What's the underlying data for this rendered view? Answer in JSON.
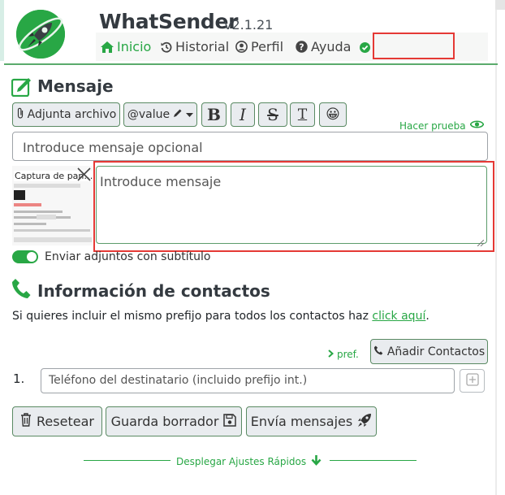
{
  "header": {
    "app_name": "WhatSender",
    "version": "v2.1.21",
    "nav": [
      {
        "label": "Inicio",
        "icon": "home-icon",
        "active": true
      },
      {
        "label": "Historial",
        "icon": "history-icon"
      },
      {
        "label": "Perfil",
        "icon": "user-circle-icon"
      },
      {
        "label": "Ayuda",
        "icon": "question-circle-icon"
      }
    ],
    "status_icon": "check-circle-icon",
    "accent_color": "#28a745",
    "highlight_color": "#e53935"
  },
  "message": {
    "title": "Mensaje",
    "toolbar": {
      "attach_label": "Adjunta archivo",
      "value_label": "@value",
      "bold": "B",
      "italic": "I",
      "strike": "S",
      "clear_format": "T",
      "emoji": "😀"
    },
    "test_label": "Hacer prueba",
    "optional_placeholder": "Introduce mensaje opcional",
    "message_placeholder": "Introduce mensaje",
    "attachment_name": "Captura de pan…",
    "caption_toggle_label": "Enviar adjuntos con subtítulo",
    "caption_toggle_on": true
  },
  "contacts": {
    "title": "Información de contactos",
    "hint_text": "Si quieres incluir el mismo prefijo para todos los contactos haz",
    "hint_link": "click aquí",
    "hint_end": ".",
    "pref_label": "pref.",
    "add_contacts_label": "Añadir Contactos",
    "rows": [
      {
        "number": "1.",
        "placeholder": "Teléfono del destinatario (incluido prefijo int.)"
      }
    ]
  },
  "actions": {
    "reset_label": "Resetear",
    "save_draft_label": "Guarda borrador",
    "send_label": "Envía mensajes"
  },
  "footer": {
    "expand_label": "Desplegar Ajustes Rápidos"
  }
}
